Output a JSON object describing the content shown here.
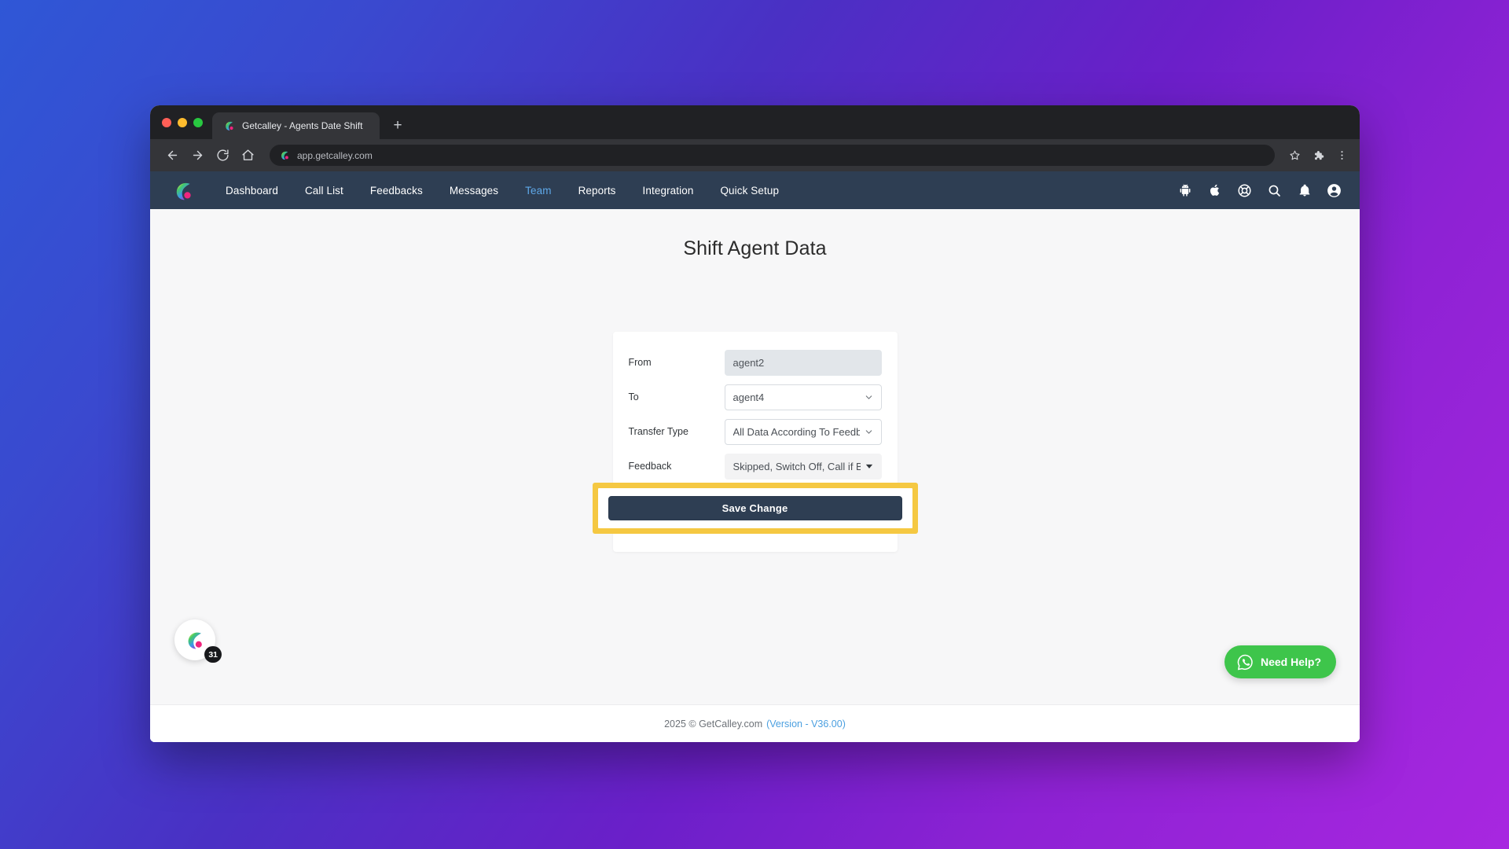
{
  "browser": {
    "tab": {
      "title": "Getcalley - Agents Date Shift",
      "favicon": "calley-logo-icon"
    },
    "new_tab_label": "+",
    "toolbar": {
      "back_icon": "back-arrow-icon",
      "forward_icon": "forward-arrow-icon",
      "reload_icon": "reload-icon",
      "home_icon": "home-icon",
      "url": "app.getcalley.com",
      "bookmark_icon": "star-icon",
      "extensions_icon": "puzzle-piece-icon",
      "menu_icon": "three-dot-menu-icon"
    }
  },
  "appbar": {
    "logo": "calley-logo-icon",
    "nav_items": [
      {
        "label": "Dashboard",
        "active": false
      },
      {
        "label": "Call List",
        "active": false
      },
      {
        "label": "Feedbacks",
        "active": false
      },
      {
        "label": "Messages",
        "active": false
      },
      {
        "label": "Team",
        "active": true
      },
      {
        "label": "Reports",
        "active": false
      },
      {
        "label": "Integration",
        "active": false
      },
      {
        "label": "Quick Setup",
        "active": false
      }
    ],
    "icons": [
      "android-icon",
      "apple-icon",
      "support-lifebuoy-icon",
      "search-icon",
      "notification-bell-icon",
      "user-account-icon"
    ],
    "colors": {
      "background": "#2e3e53",
      "active_link": "#5fa8e8"
    }
  },
  "page": {
    "title": "Shift Agent Data",
    "form": {
      "rows": [
        {
          "label": "From",
          "value": "agent2",
          "type": "text",
          "disabled": true
        },
        {
          "label": "To",
          "value": "agent4",
          "type": "select",
          "disabled": false
        },
        {
          "label": "Transfer Type",
          "value": "All Data According To Feedback",
          "type": "select",
          "disabled": false
        },
        {
          "label": "Feedback",
          "value": "Skipped, Switch Off, Call if Busy",
          "type": "multiselect",
          "disabled": false
        }
      ],
      "save_button": {
        "label": "Save Change",
        "highlighted": true,
        "highlight_color": "#f5c842",
        "button_color": "#2e3e53"
      }
    }
  },
  "widgets": {
    "floating_badge": {
      "icon": "calley-logo-icon",
      "count": "31"
    },
    "need_help": {
      "label": "Need Help?",
      "icon": "whatsapp-icon",
      "color": "#3ec54b"
    }
  },
  "footer": {
    "copyright": "2025 © GetCalley.com",
    "version": "(Version - V36.00)"
  }
}
